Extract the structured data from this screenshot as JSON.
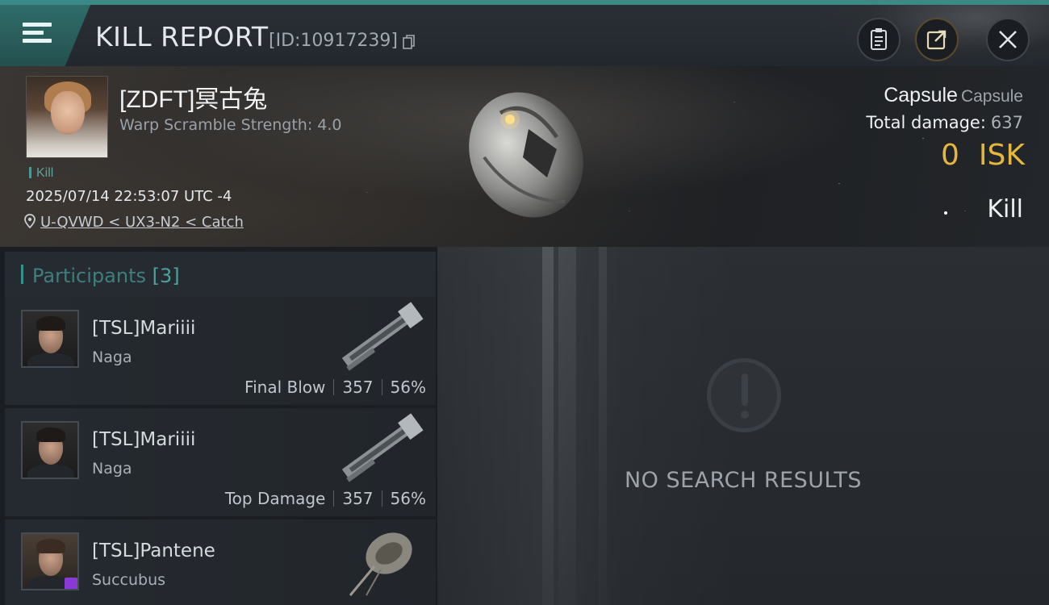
{
  "header": {
    "title": "KILL REPORT",
    "report_id": "[ID:10917239]",
    "icons": [
      "menu-icon",
      "copy-icon",
      "clipboard-icon",
      "share-icon",
      "close-icon"
    ]
  },
  "victim": {
    "name": "[ZDFT]冥古兔",
    "warp_scramble": "Warp Scramble Strength: 4.0",
    "tag": "Kill",
    "timestamp": "2025/07/14 22:53:07 UTC -4",
    "location": "U-QVWD < UX3-N2 < Catch",
    "ship_type": "Capsule",
    "ship_class": "Capsule",
    "total_damage_label": "Total damage:",
    "total_damage_value": "637",
    "isk_value": "0",
    "isk_unit": "ISK",
    "result": "Kill"
  },
  "participants": {
    "label": "Participants",
    "count": "[3]",
    "items": [
      {
        "name": "[TSL]Mariiii",
        "ship": "Naga",
        "role": "Final Blow",
        "damage": "357",
        "percent": "56%"
      },
      {
        "name": "[TSL]Mariiii",
        "ship": "Naga",
        "role": "Top Damage",
        "damage": "357",
        "percent": "56%"
      },
      {
        "name": "[TSL]Pantene",
        "ship": "Succubus",
        "role": "",
        "damage": "",
        "percent": ""
      }
    ]
  },
  "details": {
    "empty_text": "NO SEARCH RESULTS"
  },
  "colors": {
    "accent": "#3b8a86",
    "isk": "#e7b63d",
    "badge": "#8a39d6"
  }
}
